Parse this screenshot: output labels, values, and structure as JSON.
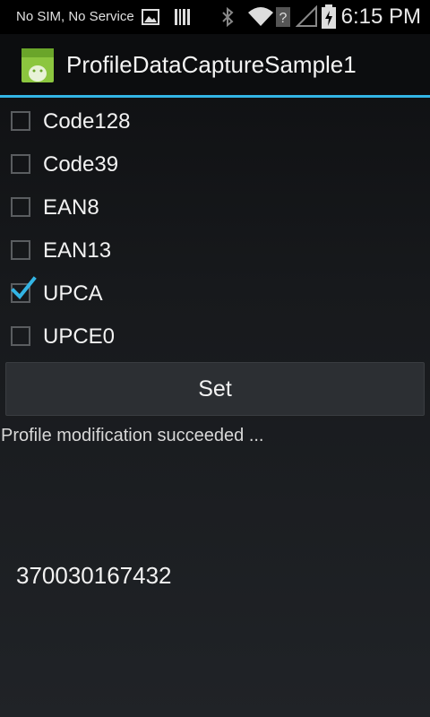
{
  "status_bar": {
    "carrier": "No SIM, No Service",
    "time": "6:15 PM",
    "icons": [
      "image-icon",
      "barcode-scanner-icon",
      "bluetooth-icon",
      "wifi-icon",
      "signal-icon",
      "battery-icon"
    ]
  },
  "action_bar": {
    "title": "ProfileDataCaptureSample1",
    "app_icon": "android-icon",
    "accent_color": "#33b5e5"
  },
  "checkboxes": [
    {
      "label": "Code128",
      "checked": false
    },
    {
      "label": "Code39",
      "checked": false
    },
    {
      "label": "EAN8",
      "checked": false
    },
    {
      "label": "EAN13",
      "checked": false
    },
    {
      "label": "UPCA",
      "checked": true
    },
    {
      "label": "UPCE0",
      "checked": false
    }
  ],
  "set_button": {
    "label": "Set"
  },
  "status_message": "Profile modification succeeded ...",
  "scanned_data": "370030167432"
}
